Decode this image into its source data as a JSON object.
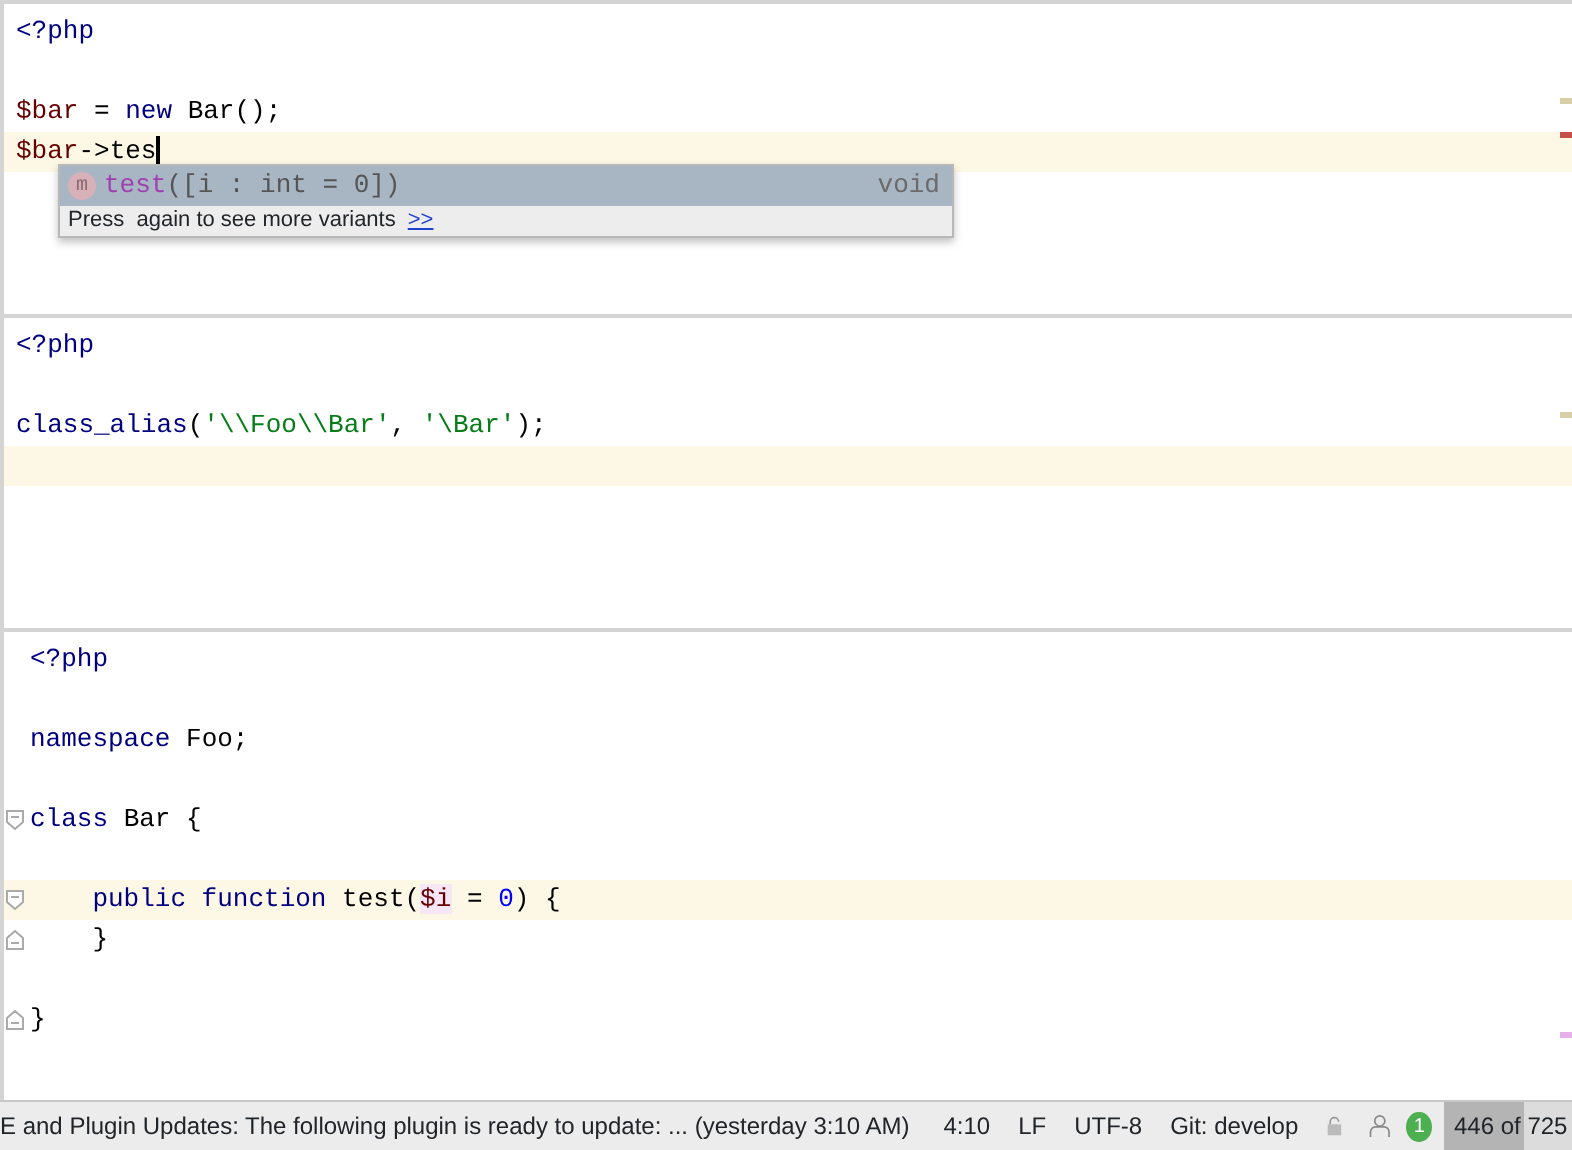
{
  "panes": [
    {
      "gutter": false,
      "lines": [
        {
          "kind": "code",
          "tokens": [
            {
              "text": "<?php",
              "kind": "keyword"
            }
          ]
        },
        {
          "kind": "blank"
        },
        {
          "kind": "code",
          "tokens": [
            {
              "text": "$bar",
              "kind": "variable"
            },
            {
              "text": " = ",
              "kind": "plain"
            },
            {
              "text": "new",
              "kind": "keyword"
            },
            {
              "text": " Bar();",
              "kind": "plain"
            }
          ]
        },
        {
          "kind": "code",
          "current": true,
          "caret": true,
          "tokens": [
            {
              "text": "$bar",
              "kind": "variable"
            },
            {
              "text": "->",
              "kind": "plain"
            },
            {
              "text": "tes",
              "kind": "plain"
            }
          ]
        }
      ],
      "popup": {
        "items": [
          {
            "icon": "m",
            "name": "test",
            "params": "([i : int = 0])",
            "type": "void",
            "selected": true
          }
        ],
        "hint": "Press  again to see more variants",
        "hint_link": ">>"
      }
    },
    {
      "gutter": false,
      "lines": [
        {
          "kind": "code",
          "tokens": [
            {
              "text": "<?php",
              "kind": "keyword"
            }
          ]
        },
        {
          "kind": "blank"
        },
        {
          "kind": "code",
          "tokens": [
            {
              "text": "class_alias",
              "kind": "function"
            },
            {
              "text": "(",
              "kind": "plain"
            },
            {
              "text": "'\\\\Foo\\\\Bar'",
              "kind": "string"
            },
            {
              "text": ", ",
              "kind": "plain"
            },
            {
              "text": "'\\Bar'",
              "kind": "string"
            },
            {
              "text": ");",
              "kind": "plain"
            }
          ]
        },
        {
          "kind": "blank",
          "current": true
        }
      ]
    },
    {
      "gutter": true,
      "lines": [
        {
          "kind": "code",
          "tokens": [
            {
              "text": "<?php",
              "kind": "keyword"
            }
          ]
        },
        {
          "kind": "blank"
        },
        {
          "kind": "code",
          "tokens": [
            {
              "text": "namespace",
              "kind": "keyword"
            },
            {
              "text": " Foo;",
              "kind": "plain"
            }
          ]
        },
        {
          "kind": "blank"
        },
        {
          "kind": "code",
          "fold_start": true,
          "tokens": [
            {
              "text": "class",
              "kind": "keyword"
            },
            {
              "text": " Bar {",
              "kind": "plain"
            }
          ]
        },
        {
          "kind": "blank"
        },
        {
          "kind": "code",
          "current": true,
          "fold_start": true,
          "indented": true,
          "tokens": [
            {
              "text": "public function",
              "kind": "keyword"
            },
            {
              "text": " test(",
              "kind": "plain"
            },
            {
              "text": "$i",
              "kind": "param"
            },
            {
              "text": " = ",
              "kind": "plain"
            },
            {
              "text": "0",
              "kind": "number"
            },
            {
              "text": ") {",
              "kind": "plain"
            }
          ]
        },
        {
          "kind": "code",
          "fold_end": true,
          "indented": true,
          "tokens": [
            {
              "text": "}",
              "kind": "plain"
            }
          ]
        },
        {
          "kind": "blank"
        },
        {
          "kind": "code",
          "fold_end": true,
          "tokens": [
            {
              "text": "}",
              "kind": "plain"
            }
          ]
        }
      ]
    }
  ],
  "status_bar": {
    "message": "E and Plugin Updates: The following plugin is ready to update: ... (yesterday 3:10 AM)",
    "position": "4:10",
    "line_separator": "LF",
    "encoding": "UTF-8",
    "vcs": "Git: develop",
    "notifications": "1",
    "memory": {
      "text": "446 of 725",
      "level": 0.62
    }
  }
}
